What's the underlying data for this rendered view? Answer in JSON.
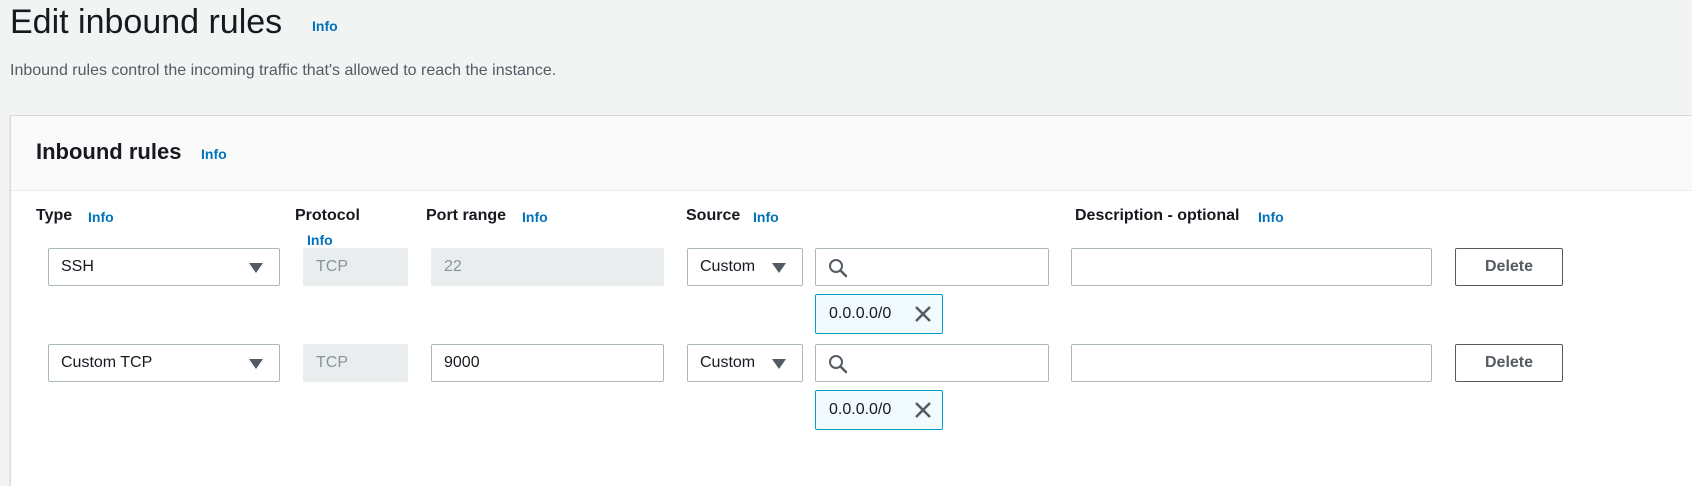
{
  "page": {
    "title": "Edit inbound rules",
    "info": "Info",
    "description": "Inbound rules control the incoming traffic that's allowed to reach the instance."
  },
  "panel": {
    "title": "Inbound rules",
    "info": "Info"
  },
  "columns": {
    "type": "Type",
    "type_info": "Info",
    "protocol": "Protocol",
    "protocol_info": "Info",
    "port_range": "Port range",
    "port_range_info": "Info",
    "source": "Source",
    "source_info": "Info",
    "description": "Description - optional",
    "description_info": "Info"
  },
  "rules": [
    {
      "type": "SSH",
      "protocol": "TCP",
      "port_range": "22",
      "source": "Custom",
      "search_value": "",
      "token": "0.0.0.0/0",
      "description": "",
      "delete_label": "Delete"
    },
    {
      "type": "Custom TCP",
      "protocol": "TCP",
      "port_range": "9000",
      "source": "Custom",
      "search_value": "",
      "token": "0.0.0.0/0",
      "description": "",
      "delete_label": "Delete"
    }
  ],
  "colors": {
    "link": "#0073bb",
    "token_border": "#00a1c9",
    "token_bg": "#f1faff",
    "disabled_bg": "#eaeded",
    "page_bg": "#f2f3f3"
  },
  "icons": [
    "search-icon",
    "chevron-down-icon",
    "close-icon"
  ]
}
